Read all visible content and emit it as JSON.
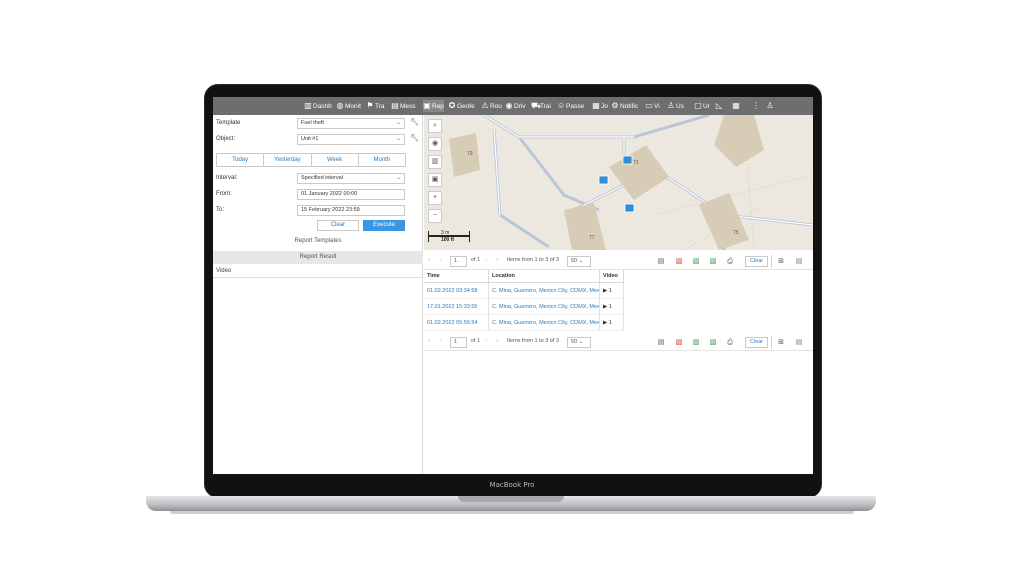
{
  "device": {
    "label": "MacBook Pro"
  },
  "nav": {
    "items": [
      {
        "icon": "chart-icon",
        "glyph": "▥",
        "label": "Dashb"
      },
      {
        "icon": "globe-icon",
        "glyph": "◍",
        "label": "Monit"
      },
      {
        "icon": "flag-icon",
        "glyph": "⚑",
        "label": "Tra"
      },
      {
        "icon": "messages-icon",
        "glyph": "▤",
        "label": "Mess"
      },
      {
        "icon": "reports-icon",
        "glyph": "▣",
        "label": "Rep"
      },
      {
        "icon": "geofence-icon",
        "glyph": "✪",
        "label": "Geofe"
      },
      {
        "icon": "routes-icon",
        "glyph": "⚠",
        "label": "Rou"
      },
      {
        "icon": "drivers-icon",
        "glyph": "◉",
        "label": "Driv"
      },
      {
        "icon": "trailers-icon",
        "glyph": "⛟",
        "label": "Trai"
      },
      {
        "icon": "passengers-icon",
        "glyph": "☺",
        "label": "Passe"
      },
      {
        "icon": "jobs-icon",
        "glyph": "▦",
        "label": "Jo"
      },
      {
        "icon": "notifications-icon",
        "glyph": "⚙",
        "label": "Notific"
      },
      {
        "icon": "video-icon",
        "glyph": "▭",
        "label": "Vi"
      },
      {
        "icon": "user-icon",
        "glyph": "♙",
        "label": "Us"
      },
      {
        "icon": "units-icon",
        "glyph": "▢",
        "label": "Ur"
      },
      {
        "icon": "tools-icon",
        "glyph": "◺",
        "label": ""
      }
    ],
    "apps_icon": "▦",
    "more_icon": "⋮",
    "account_icon": "♙"
  },
  "left": {
    "template_label": "Template",
    "template_value": "Fuel theft",
    "object_label": "Object:",
    "object_value": "Unit #1",
    "quick": [
      "Today",
      "Yesterday",
      "Week",
      "Month"
    ],
    "interval_label": "Interval:",
    "interval_value": "Specified interval",
    "from_label": "From:",
    "from_value": "01 January 2022 00:00",
    "to_label": "To:",
    "to_value": "15 February 2022 23:59",
    "clear_label": "Clear",
    "execute_label": "Execute",
    "report_templates": "Report Templates",
    "report_result": "Report Result",
    "video_item": "Video"
  },
  "map": {
    "building_labels": [
      "79",
      "71",
      "77",
      "75"
    ],
    "scale_m": "3 m",
    "scale_ft": "100 ft"
  },
  "pager": {
    "first": "«",
    "prev": "‹",
    "page": "1",
    "of": "of 1",
    "next": "›",
    "last": "»",
    "items_text": "Items from 1 to 3 of 3",
    "per_page": "50",
    "clear_label": "Clear"
  },
  "table": {
    "headers": [
      "Time",
      "Location",
      "Video"
    ],
    "rows": [
      {
        "time": "01.02.2022 03:34:58",
        "location": "C. Mina, Guerrero, Mexico City, CDMX, Mexi",
        "video": "1"
      },
      {
        "time": "17.01.2022 15:33:55",
        "location": "C. Mina, Guerrero, Mexico City, CDMX, Mexi",
        "video": "1"
      },
      {
        "time": "01.02.2022 05:56:54",
        "location": "C. Mina, Guerrero, Mexico City, CDMX, Mexi",
        "video": "1"
      }
    ]
  }
}
